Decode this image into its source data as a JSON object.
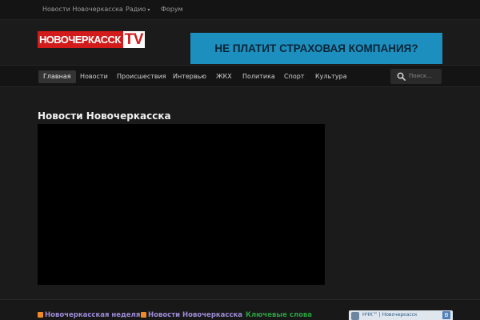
{
  "topnav": {
    "items": [
      {
        "label": "Новости Новочеркасска"
      },
      {
        "label": "Радио"
      },
      {
        "label": "Форум"
      }
    ]
  },
  "header": {
    "logo_text": "НОВОЧЕРКАССК",
    "logo_tv": "TV",
    "banner_text": "НЕ ПЛАТИТ СТРАХОВАЯ КОМПАНИЯ?"
  },
  "mainnav": {
    "tabs": [
      {
        "label": "Главная"
      },
      {
        "label": "Новости"
      },
      {
        "label": "Происшествия"
      },
      {
        "label": "Интервью"
      },
      {
        "label": "ЖКХ"
      },
      {
        "label": "Политика"
      },
      {
        "label": "Спорт"
      },
      {
        "label": "Культура"
      }
    ],
    "search_placeholder": "Поиск..."
  },
  "main": {
    "title": "Новости Новочеркасска"
  },
  "footer": {
    "links": [
      {
        "label": "Новочеркасская неделя"
      },
      {
        "label": "Новости Новочеркасска"
      },
      {
        "label": "Ключевые слова"
      }
    ],
    "widget_text": "НЧК™ | Новочеркасск",
    "widget_badge": "В"
  },
  "colors": {
    "background": "#1b1b1b",
    "logo_red": "#d21b1b",
    "banner_blue": "#1c8fbf",
    "rss_orange": "#f08a24",
    "link_purple": "#9d8bd6",
    "link_green": "#2aa040"
  },
  "icons": {
    "search": "search-icon",
    "dropdown": "chevron-down-icon",
    "rss": "rss-icon"
  }
}
